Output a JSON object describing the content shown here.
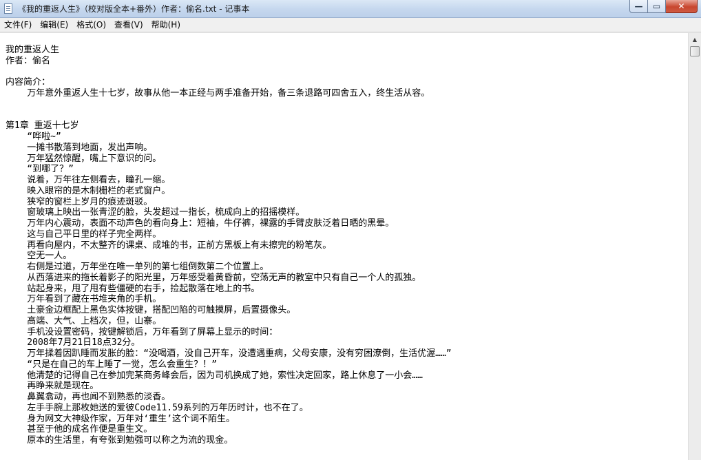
{
  "window": {
    "title": "《我的重返人生》（校对版全本+番外）作者：偷名.txt - 记事本",
    "minimize_glyph": "—",
    "maximize_glyph": "▭",
    "close_glyph": "✕"
  },
  "menu": [
    "文件(F)",
    "编辑(E)",
    "格式(O)",
    "查看(V)",
    "帮助(H)"
  ],
  "text_lines": [
    "我的重返人生",
    "作者：偷名",
    "",
    "内容简介：",
    "    万年意外重返人生十七岁，故事从他一本正经与两手准备开始，备三条退路可四舍五入，终生活从容。",
    "",
    "",
    "第1章 重返十七岁",
    "    “哗啦~”",
    "    一摊书散落到地面，发出声响。",
    "    万年猛然惊醒，嘴上下意识的问。",
    "    “到哪了？”",
    "    说着，万年往左侧看去，瞳孔一缩。",
    "    映入眼帘的是木制栅栏的老式窗户。",
    "    狭窄的窗栏上岁月的痕迹斑驳。",
    "    窗玻璃上映出一张青涩的脸，头发超过一指长，梳成向上的招摇模样。",
    "    万年内心震动，表面不动声色的看向身上：短袖，牛仔裤，裸露的手臂皮肤泛着日晒的黑晕。",
    "    这与自己平日里的样子完全两样。",
    "    再看向屋内，不太整齐的课桌、成堆的书，正前方黑板上有未擦完的粉笔灰。",
    "    空无一人。",
    "    右侧是过道，万年坐在唯一单列的第七组倒数第二个位置上。",
    "    从西落进来的拖长着影子的阳光里，万年感受着黄昏前，空荡无声的教室中只有自己一个人的孤独。",
    "    站起身来，甩了甩有些僵硬的右手，捡起散落在地上的书。",
    "    万年看到了藏在书堆夹角的手机。",
    "    土豪金边框配上黑色实体按键，搭配凹陷的可触摸屏，后置摄像头。",
    "    高端、大气、上档次，但，山寨。",
    "    手机没设置密码，按键解锁后，万年看到了屏幕上显示的时间：",
    "    2008年7月21日18点32分。",
    "    万年揉着因趴睡而发胀的脸：“没喝酒，没自己开车，没遭遇重病，父母安康，没有穷困潦倒，生活优渥……”",
    "    “只是在自己的车上睡了一觉，怎么会重生？！”",
    "    他清楚的记得自己在参加完某商务峰会后，因为司机换成了她，索性决定回家，路上休息了一小会……",
    "    再睁来就是现在。",
    "    鼻翼翕动，再也闻不到熟悉的淡香。",
    "    左手手腕上那枚她送的爱彼Code11.59系列的万年历时计，也不在了。",
    "    身为网文大神级作家，万年对‘重生’这个词不陌生。",
    "    甚至于他的成名作便是重生文。",
    "    原本的生活里，有夸张到勉强可以称之为流的现金。"
  ]
}
